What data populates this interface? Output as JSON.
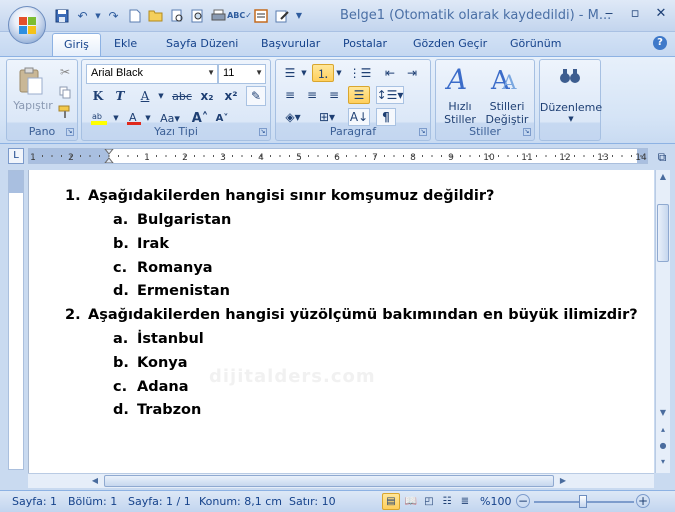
{
  "window": {
    "title": "Belge1 (Otomatik olarak kaydedildi) - M...",
    "minimize": "▭",
    "restore": "▫",
    "close": "✕"
  },
  "tabs": [
    {
      "label": "Giriş",
      "active": true
    },
    {
      "label": "Ekle"
    },
    {
      "label": "Sayfa Düzeni"
    },
    {
      "label": "Başvurular"
    },
    {
      "label": "Postalar"
    },
    {
      "label": "Gözden Geçir"
    },
    {
      "label": "Görünüm"
    }
  ],
  "ribbon": {
    "pano": {
      "label": "Pano",
      "paste": "Yapıştır"
    },
    "font": {
      "label": "Yazı Tipi",
      "family": "Arial Black",
      "size": "11"
    },
    "paragraph": {
      "label": "Paragraf"
    },
    "styles": {
      "label": "Stiller",
      "quick": "Hızlı\nStiller",
      "change": "Stilleri\nDeğiştir"
    },
    "editing": {
      "label": "Düzenleme"
    }
  },
  "document": {
    "watermark": "dijitalders.com",
    "questions": [
      {
        "number": "1.",
        "text": "Aşağıdakilerden hangisi sınır komşumuz değildir?",
        "answers": [
          {
            "letter": "a.",
            "text": "Bulgaristan"
          },
          {
            "letter": "b.",
            "text": "Irak"
          },
          {
            "letter": "c.",
            "text": "Romanya"
          },
          {
            "letter": "d.",
            "text": "Ermenistan"
          }
        ]
      },
      {
        "number": "2.",
        "text": "Aşağıdakilerden hangisi yüzölçümü bakımından en büyük ilimizdir?",
        "answers": [
          {
            "letter": "a.",
            "text": "İstanbul"
          },
          {
            "letter": "b.",
            "text": "Konya"
          },
          {
            "letter": "c.",
            "text": "Adana"
          },
          {
            "letter": "d.",
            "text": "Trabzon"
          }
        ]
      }
    ]
  },
  "ruler": {
    "marks": [
      "1",
      "2",
      "1",
      "2",
      "3",
      "4",
      "5",
      "6",
      "7",
      "8",
      "9",
      "10",
      "11",
      "12",
      "13",
      "14",
      "15"
    ]
  },
  "status": {
    "page": "Sayfa: 1",
    "section": "Bölüm: 1",
    "pages": "Sayfa: 1 / 1",
    "position": "Konum: 8,1 cm",
    "line": "Satır: 10",
    "zoom": "%100"
  }
}
